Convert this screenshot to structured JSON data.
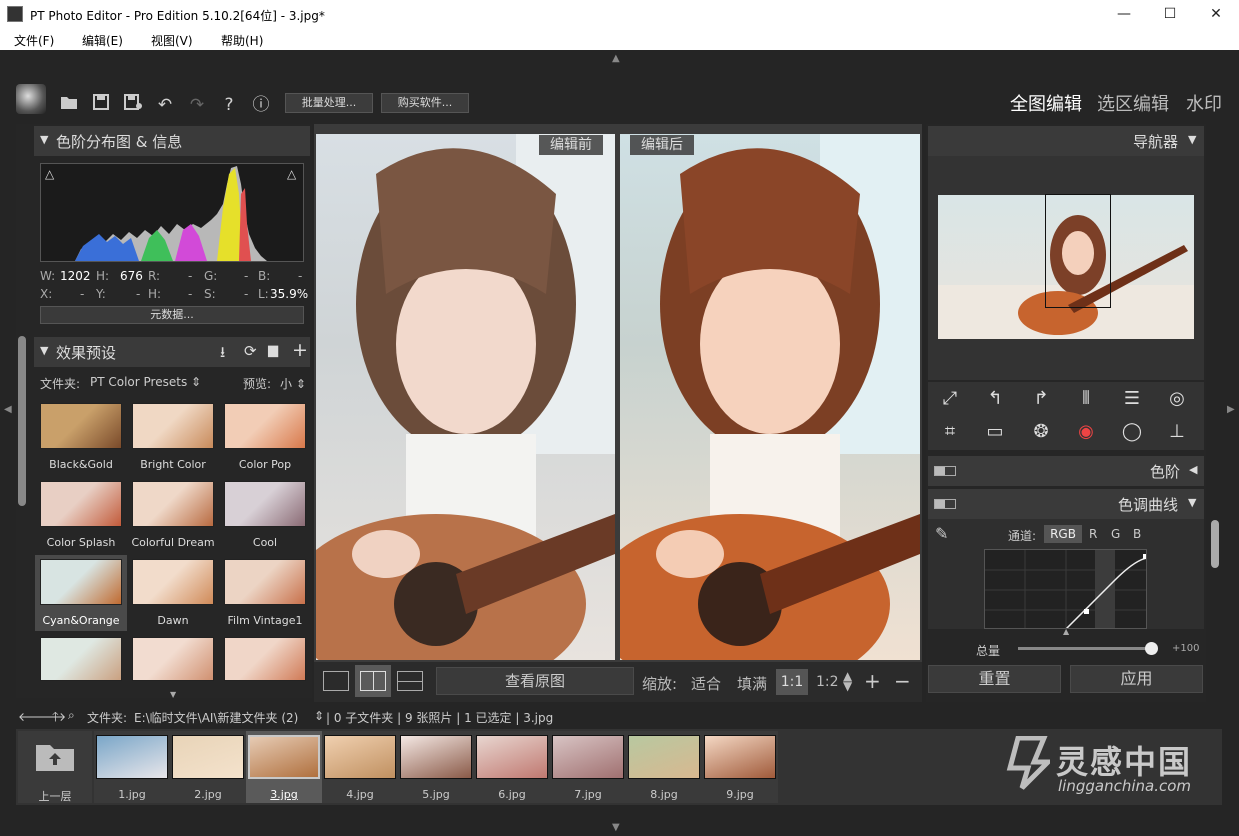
{
  "window": {
    "title": "PT Photo Editor - Pro Edition 5.10.2[64位] - 3.jpg*",
    "minimize": "—",
    "maximize": "☐",
    "close": "✕"
  },
  "menu": [
    "文件(F)",
    "编辑(E)",
    "视图(V)",
    "帮助(H)"
  ],
  "toolbar": {
    "batch": "批量处理...",
    "buy": "购买软件..."
  },
  "modes": [
    "全图编辑",
    "选区编辑",
    "水印"
  ],
  "histogram": {
    "title": "色阶分布图 & 信息",
    "w_label": "W:",
    "w_value": "1202",
    "h_label": "H:",
    "h_value": "676",
    "r_label": "R:",
    "r_value": "-",
    "g_label": "G:",
    "g_value": "-",
    "b_label": "B:",
    "b_value": "-",
    "x_label": "X:",
    "x_value": "-",
    "y_label": "Y:",
    "y_value": "-",
    "hh_label": "H:",
    "hh_value": "-",
    "s_label": "S:",
    "s_value": "-",
    "l_label": "L:",
    "l_value": "35.9%",
    "metadata_button": "元数据..."
  },
  "presets": {
    "title": "效果预设",
    "folder_label": "文件夹:",
    "folder_value": "PT Color Presets",
    "preview_label": "预览:",
    "preview_value": "小",
    "items": [
      "Black&Gold",
      "Bright Color",
      "Color Pop",
      "Color Splash",
      "Colorful Dream",
      "Cool",
      "Cyan&Orange",
      "Dawn",
      "Film Vintage1"
    ],
    "selected": "Cyan&Orange"
  },
  "canvas": {
    "before_label": "编辑前",
    "after_label": "编辑后",
    "view_original": "查看原图",
    "zoom_label": "缩放:",
    "fit": "适合",
    "fill": "填满",
    "zoom_1_1": "1:1",
    "zoom_1_2": "1:2"
  },
  "navigator": {
    "title": "导航器"
  },
  "levels": {
    "title": "色阶"
  },
  "curves": {
    "title": "色调曲线",
    "channel_label": "通道:",
    "channels": [
      "RGB",
      "R",
      "G",
      "B"
    ],
    "selected_channel": "RGB"
  },
  "amount": {
    "label": "总量",
    "value": "+100",
    "fraction": 1.0
  },
  "actions": {
    "reset": "重置",
    "apply": "应用"
  },
  "filebar": {
    "folder_label": "文件夹:",
    "path": "E:\\临时文件\\AI\\新建文件夹 (2)",
    "status": "| 0 子文件夹 | 9 张照片 | 1 已选定 | 3.jpg"
  },
  "filmstrip": {
    "up_label": "上一层",
    "files": [
      "1.jpg",
      "2.jpg",
      "3.jpg",
      "4.jpg",
      "5.jpg",
      "6.jpg",
      "7.jpg",
      "8.jpg",
      "9.jpg"
    ],
    "selected": "3.jpg"
  },
  "watermark": {
    "brand": "灵感中国",
    "url": "lingganchina.com"
  },
  "colors": {
    "accent_border": "#c8c8c8",
    "panel": "#2d2d2d",
    "background": "#252525"
  }
}
